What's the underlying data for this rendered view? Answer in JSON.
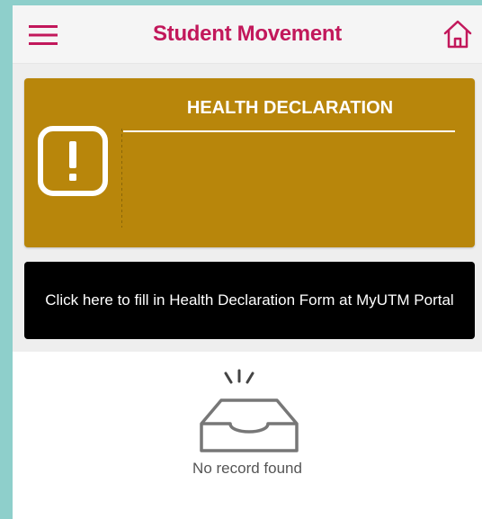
{
  "header": {
    "title": "Student Movement",
    "menu_icon": "hamburger-menu-icon",
    "home_icon": "home-icon"
  },
  "health_card": {
    "title": "HEALTH DECLARATION",
    "icon": "exclamation-alert-icon",
    "background_color": "#b8860b"
  },
  "action_button": {
    "label": "Click here to fill in Health Declaration Form at MyUTM Portal"
  },
  "empty_state": {
    "icon": "empty-inbox-icon",
    "message": "No record found"
  },
  "colors": {
    "accent": "#c2185b",
    "button_bg": "#000000",
    "screen_border": "#8ecfcb"
  }
}
